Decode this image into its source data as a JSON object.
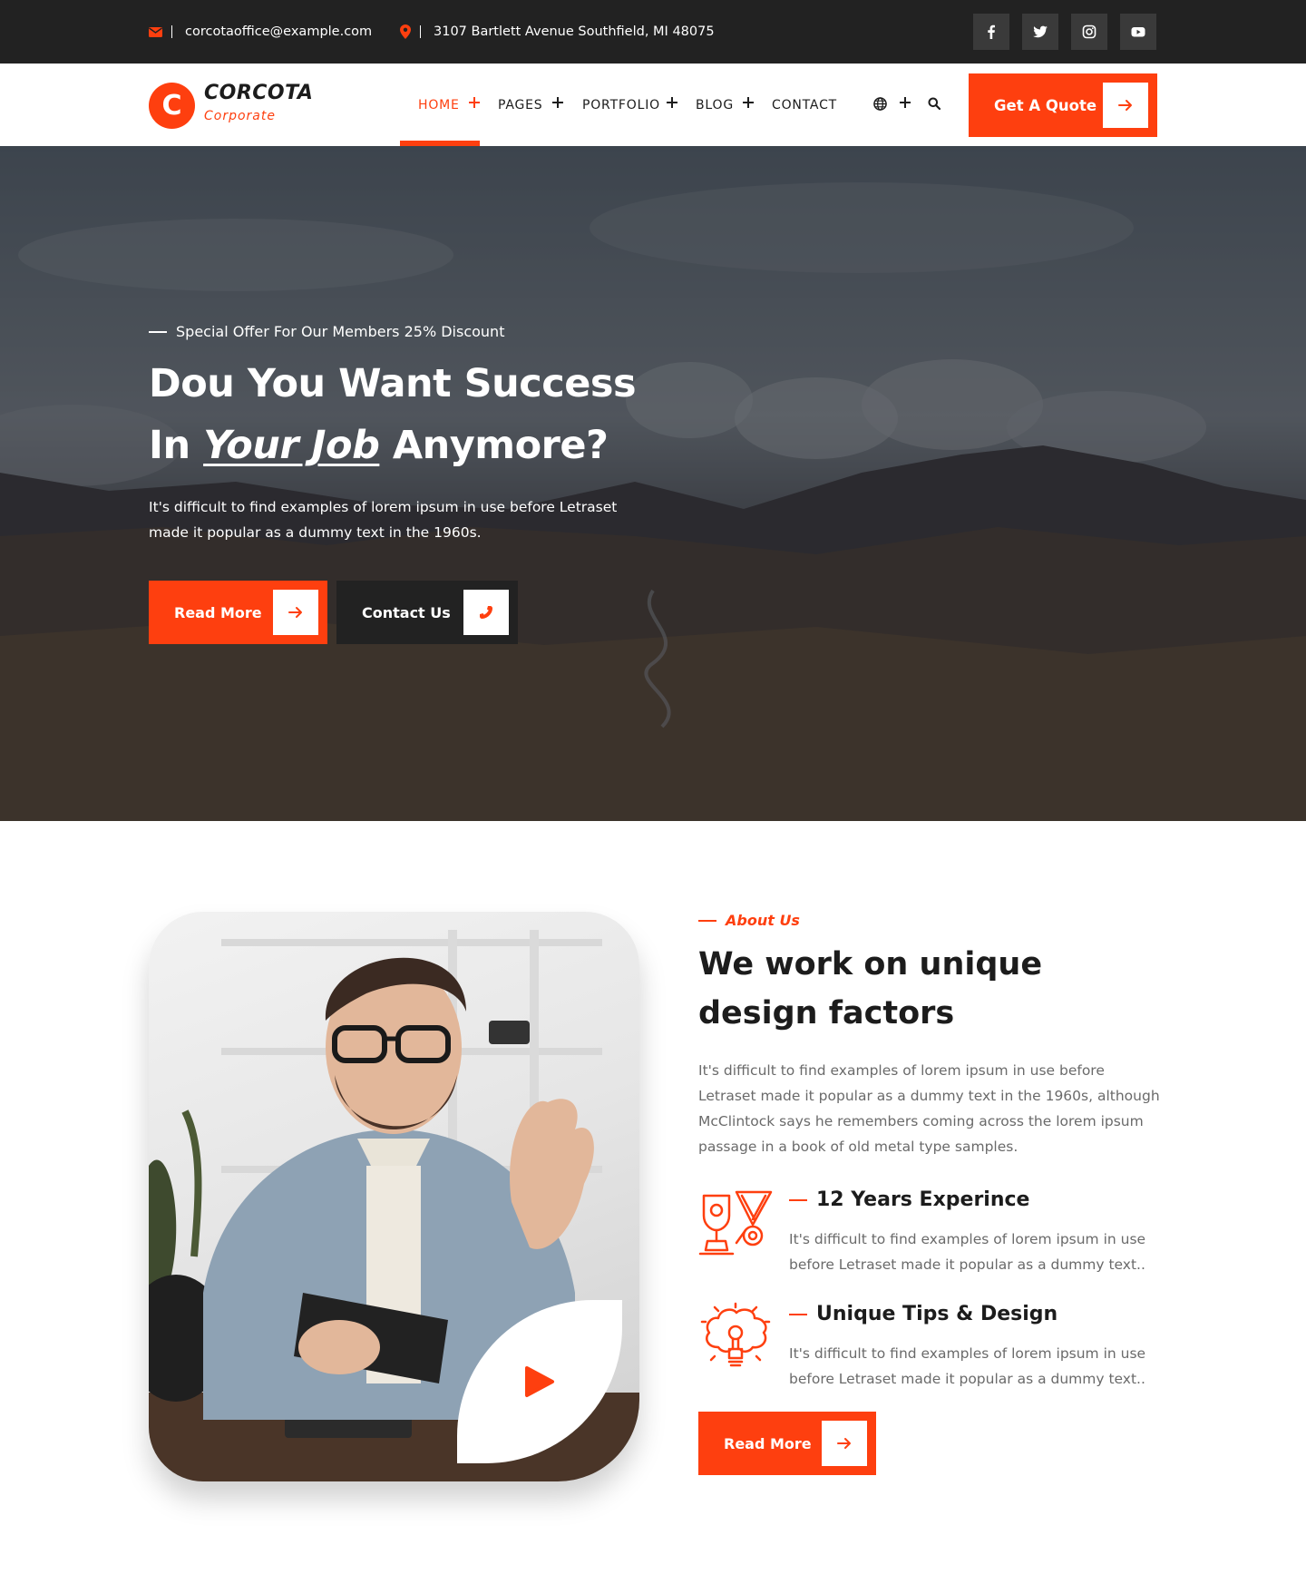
{
  "topbar": {
    "email": "corcotaoffice@example.com",
    "address": "3107 Bartlett Avenue Southfield, MI 48075",
    "socials": [
      "facebook-icon",
      "twitter-icon",
      "instagram-icon",
      "youtube-icon"
    ]
  },
  "brand": {
    "logo_letter": "C",
    "name": "CORCOTA",
    "tagline": "Corporate",
    "accent_color": "#fe3f0f",
    "dark_color": "#222222"
  },
  "nav": {
    "items": [
      {
        "label": "HOME",
        "active": true,
        "has_submenu": true
      },
      {
        "label": "PAGES",
        "active": false,
        "has_submenu": true
      },
      {
        "label": "PORTFOLIO",
        "active": false,
        "has_submenu": true
      },
      {
        "label": "BLOG",
        "active": false,
        "has_submenu": true
      },
      {
        "label": "CONTACT",
        "active": false,
        "has_submenu": false
      }
    ],
    "quote_button": "Get A Quote"
  },
  "hero": {
    "eyebrow": "Special Offer For Our Members 25% Discount",
    "title_line1": "Dou You Want Success",
    "title_line2_prefix": "In",
    "title_line2_emphasis": "Your Job",
    "title_line2_suffix": "Anymore?",
    "description": "It's difficult to find examples of lorem ipsum in use before Letraset made it popular as a dummy text in the 1960s.",
    "primary_button": "Read More",
    "secondary_button": "Contact Us"
  },
  "about": {
    "eyebrow": "About Us",
    "title": "We work on unique design factors",
    "description": "It's difficult to find examples of lorem ipsum in use before Letraset made it popular as a dummy text in the 1960s, although McClintock says he remembers coming across the lorem ipsum passage in a book of old metal type samples.",
    "features": [
      {
        "icon": "trophy-award-icon",
        "title": "12 Years Experince",
        "description": "It's difficult to find examples of lorem ipsum in use before Letraset made it popular as a dummy text.."
      },
      {
        "icon": "brain-bulb-icon",
        "title": "Unique Tips & Design",
        "description": "It's difficult to find examples of lorem ipsum in use before Letraset made it popular as a dummy text.."
      }
    ],
    "button": "Read More"
  }
}
